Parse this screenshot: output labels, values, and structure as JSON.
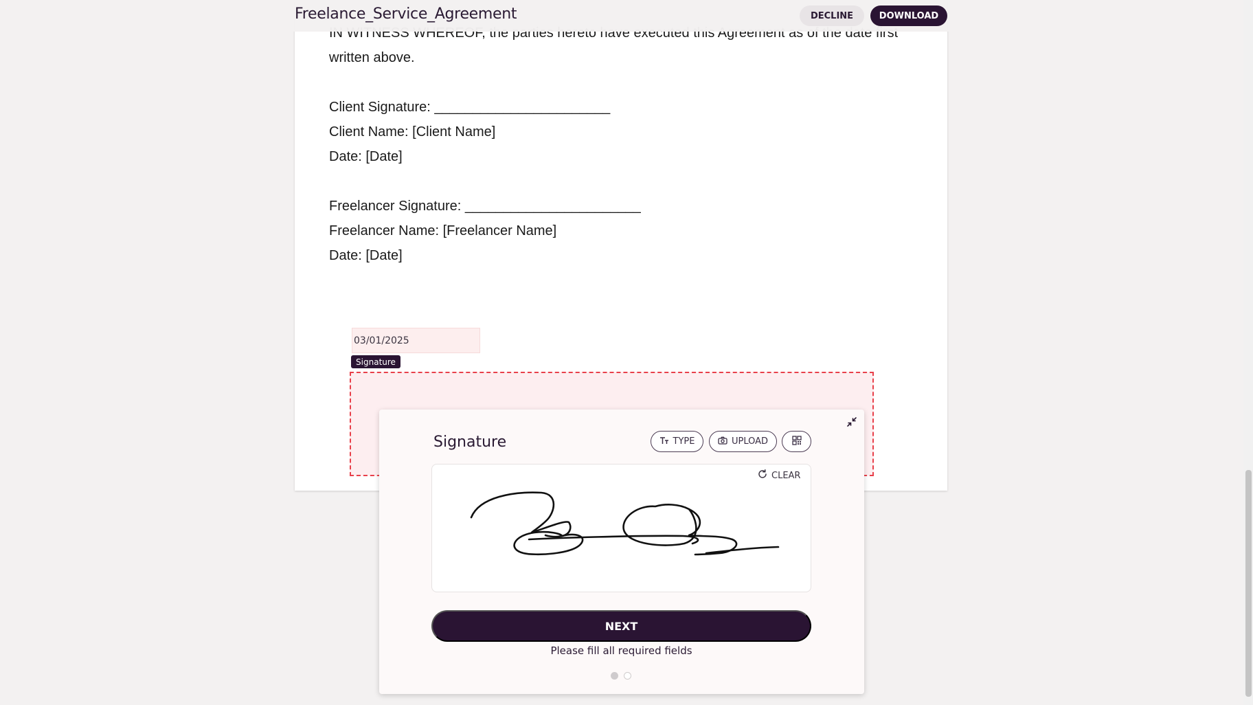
{
  "header": {
    "title": "Freelance_Service_Agreement",
    "decline_label": "DECLINE",
    "download_label": "DOWNLOAD"
  },
  "document": {
    "witness_line_1": "IN WITNESS WHEREOF, the parties hereto have executed this Agreement as of the date first",
    "witness_line_2": "written above.",
    "client_signature": "Client Signature: _______________________",
    "client_name": "Client Name: [Client Name]",
    "client_date": "Date: [Date]",
    "freelancer_signature": "Freelancer Signature: _______________________",
    "freelancer_name": "Freelancer Name: [Freelancer Name]",
    "freelancer_date": "Date: [Date]"
  },
  "fields": {
    "date_value": "03/01/2025",
    "signature_tag": "Signature"
  },
  "signature_panel": {
    "title": "Signature",
    "type_label": "TYPE",
    "upload_label": "UPLOAD",
    "clear_label": "CLEAR",
    "next_label": "NEXT",
    "hint": "Please fill all required fields",
    "pager_current": 1,
    "pager_total": 2
  },
  "icons": {
    "type": "text-size-icon",
    "upload": "camera-icon",
    "qr": "qr-code-icon",
    "clear": "refresh-icon",
    "collapse": "collapse-icon"
  },
  "colors": {
    "brand_dark": "#2a1433",
    "signature_zone_border": "#e8404a",
    "signature_zone_fill": "#fdeef0"
  }
}
